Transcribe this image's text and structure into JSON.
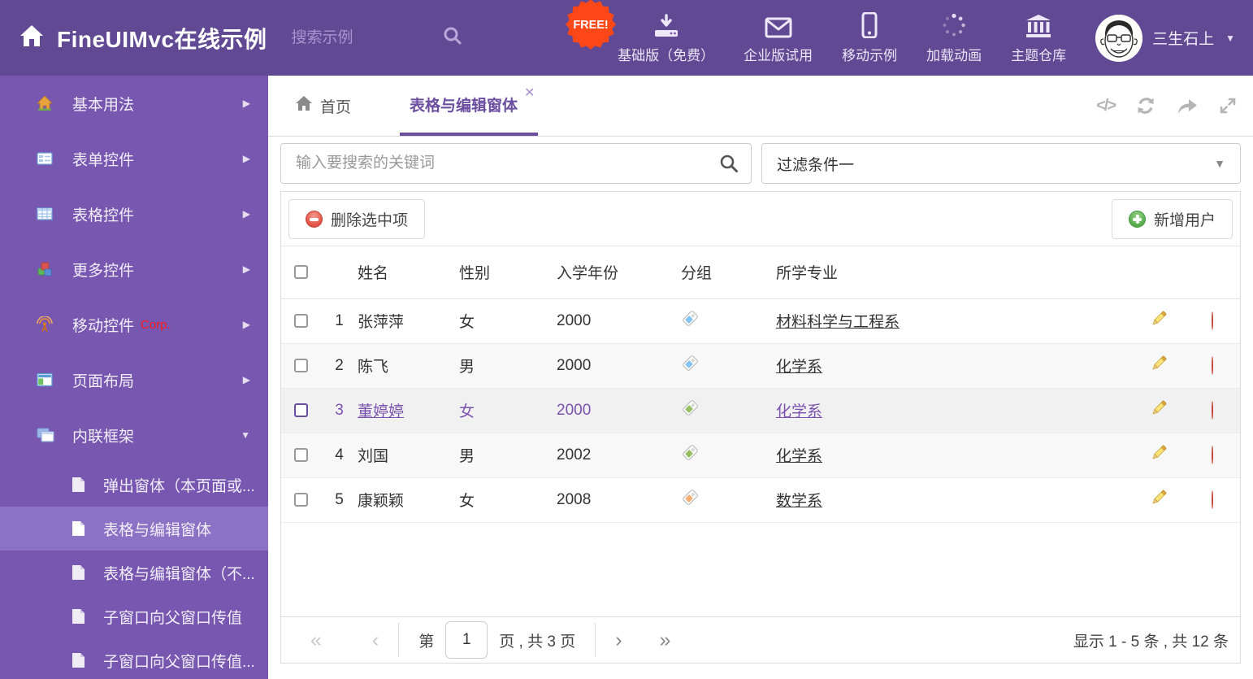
{
  "header": {
    "title": "FineUIMvc在线示例",
    "search_placeholder": "搜索示例",
    "free_badge": "FREE!",
    "nav": [
      {
        "label": "基础版（免费）",
        "icon": "download-icon"
      },
      {
        "label": "企业版试用",
        "icon": "mail-icon"
      },
      {
        "label": "移动示例",
        "icon": "mobile-icon"
      },
      {
        "label": "加载动画",
        "icon": "spinner-icon"
      },
      {
        "label": "主题仓库",
        "icon": "bank-icon"
      }
    ],
    "username": "三生石上"
  },
  "sidebar": {
    "items": [
      {
        "label": "基本用法"
      },
      {
        "label": "表单控件"
      },
      {
        "label": "表格控件"
      },
      {
        "label": "更多控件"
      },
      {
        "label": "移动控件",
        "badge": "Corp."
      },
      {
        "label": "页面布局"
      },
      {
        "label": "内联框架"
      }
    ],
    "subitems": [
      {
        "label": "弹出窗体（本页面或..."
      },
      {
        "label": "表格与编辑窗体"
      },
      {
        "label": "表格与编辑窗体（不..."
      },
      {
        "label": "子窗口向父窗口传值"
      },
      {
        "label": "子窗口向父窗口传值..."
      }
    ]
  },
  "tabs": {
    "home": "首页",
    "active": "表格与编辑窗体"
  },
  "filters": {
    "search_placeholder": "输入要搜索的关键词",
    "dropdown_value": "过滤条件一"
  },
  "grid": {
    "delete_button": "删除选中项",
    "add_button": "新增用户",
    "columns": {
      "name": "姓名",
      "gender": "性别",
      "year": "入学年份",
      "group": "分组",
      "major": "所学专业"
    },
    "rows": [
      {
        "num": "1",
        "name": "张萍萍",
        "gender": "女",
        "year": "2000",
        "tag_color": "#85C4F0",
        "major": "材料科学与工程系"
      },
      {
        "num": "2",
        "name": "陈飞",
        "gender": "男",
        "year": "2000",
        "tag_color": "#85C4F0",
        "major": "化学系"
      },
      {
        "num": "3",
        "name": "董婷婷",
        "gender": "女",
        "year": "2000",
        "tag_color": "#96BE62",
        "major": "化学系",
        "selected": true
      },
      {
        "num": "4",
        "name": "刘国",
        "gender": "男",
        "year": "2002",
        "tag_color": "#96BE62",
        "major": "化学系"
      },
      {
        "num": "5",
        "name": "康颖颖",
        "gender": "女",
        "year": "2008",
        "tag_color": "#F5AE73",
        "major": "数学系"
      }
    ],
    "pager": {
      "prefix": "第",
      "page": "1",
      "suffix": "页 , 共 3 页",
      "summary": "显示 1 - 5 条 , 共 12 条"
    }
  },
  "colors": {
    "header_bg": "#614A93",
    "sidebar_bg": "#7757AF",
    "sidebar_selected_bg": "#8C72C4",
    "accent_purple": "#6C4EA1",
    "selected_row_text": "#7A52AD",
    "free_badge_bg": "#FF4718",
    "delete_red": "#E2574A",
    "add_green": "#5CB052"
  }
}
